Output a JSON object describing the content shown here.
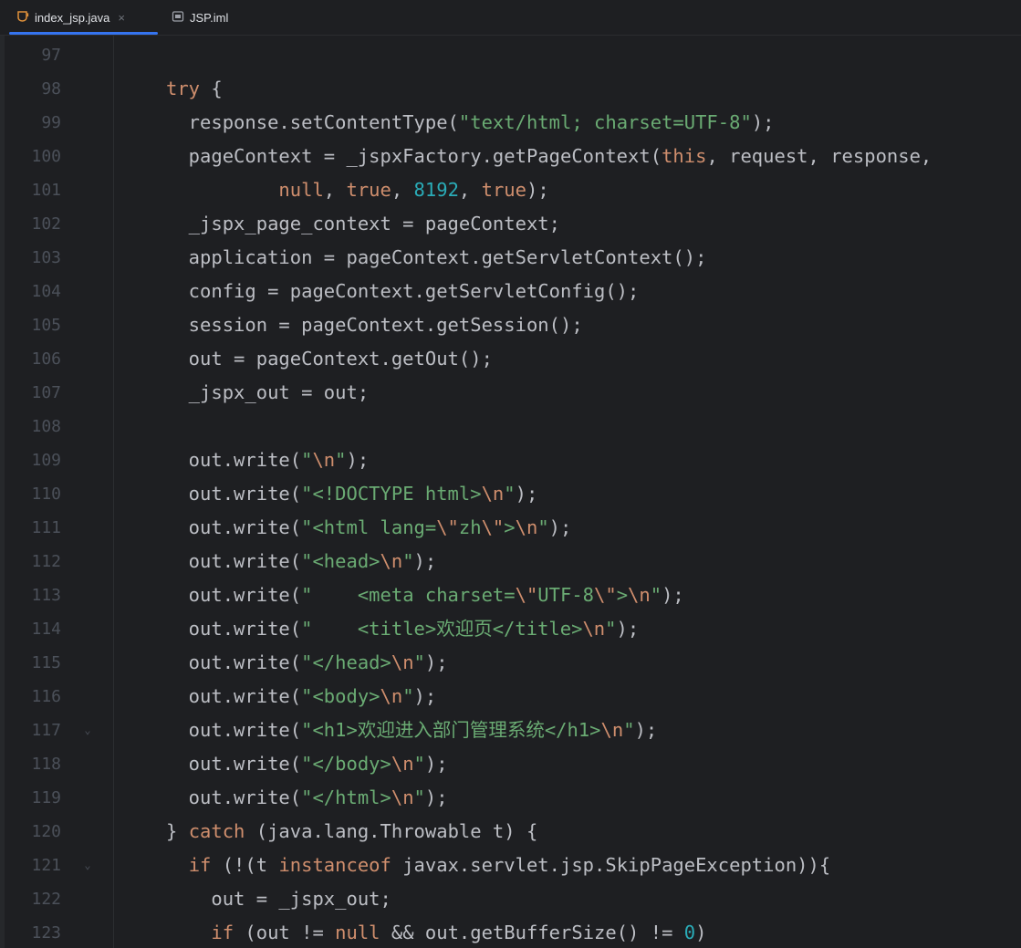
{
  "tabs": [
    {
      "label": "index_jsp.java",
      "active": true,
      "icon": "java-file-icon",
      "close": "×"
    },
    {
      "label": "JSP.iml",
      "active": false,
      "icon": "module-file-icon"
    }
  ],
  "colors": {
    "background": "#1e1f22",
    "text": "#bcbec4",
    "keyword": "#cf8e6d",
    "string": "#6aab73",
    "number": "#2aacb8",
    "line_number": "#4b5059",
    "accent": "#3574f0"
  },
  "fold_markers": {
    "117": "⌄",
    "121": "⌄"
  },
  "lines": [
    {
      "n": "97",
      "tokens": []
    },
    {
      "n": "98",
      "tokens": [
        [
          "k",
          "try"
        ],
        [
          "t",
          " {"
        ]
      ]
    },
    {
      "n": "99",
      "tokens": [
        [
          "t",
          "  response.setContentType("
        ],
        [
          "s",
          "\"text/html; charset=UTF-8\""
        ],
        [
          "t",
          ");"
        ]
      ]
    },
    {
      "n": "100",
      "tokens": [
        [
          "t",
          "  pageContext = _jspxFactory.getPageContext("
        ],
        [
          "k",
          "this"
        ],
        [
          "t",
          ", request, response,"
        ]
      ]
    },
    {
      "n": "101",
      "tokens": [
        [
          "t",
          "          "
        ],
        [
          "k",
          "null"
        ],
        [
          "t",
          ", "
        ],
        [
          "k",
          "true"
        ],
        [
          "t",
          ", "
        ],
        [
          "n",
          "8192"
        ],
        [
          "t",
          ", "
        ],
        [
          "k",
          "true"
        ],
        [
          "t",
          ");"
        ]
      ]
    },
    {
      "n": "102",
      "tokens": [
        [
          "t",
          "  _jspx_page_context = pageContext;"
        ]
      ]
    },
    {
      "n": "103",
      "tokens": [
        [
          "t",
          "  application = pageContext.getServletContext();"
        ]
      ]
    },
    {
      "n": "104",
      "tokens": [
        [
          "t",
          "  config = pageContext.getServletConfig();"
        ]
      ]
    },
    {
      "n": "105",
      "tokens": [
        [
          "t",
          "  session = pageContext.getSession();"
        ]
      ]
    },
    {
      "n": "106",
      "tokens": [
        [
          "t",
          "  out = pageContext.getOut();"
        ]
      ]
    },
    {
      "n": "107",
      "tokens": [
        [
          "t",
          "  _jspx_out = out;"
        ]
      ]
    },
    {
      "n": "108",
      "tokens": []
    },
    {
      "n": "109",
      "tokens": [
        [
          "t",
          "  out.write("
        ],
        [
          "s",
          "\""
        ],
        [
          "e",
          "\\n"
        ],
        [
          "s",
          "\""
        ],
        [
          "t",
          ");"
        ]
      ]
    },
    {
      "n": "110",
      "tokens": [
        [
          "t",
          "  out.write("
        ],
        [
          "s",
          "\"<!DOCTYPE html>"
        ],
        [
          "e",
          "\\n"
        ],
        [
          "s",
          "\""
        ],
        [
          "t",
          ");"
        ]
      ]
    },
    {
      "n": "111",
      "tokens": [
        [
          "t",
          "  out.write("
        ],
        [
          "s",
          "\"<html lang="
        ],
        [
          "e",
          "\\\""
        ],
        [
          "s",
          "zh"
        ],
        [
          "e",
          "\\\""
        ],
        [
          "s",
          ">"
        ],
        [
          "e",
          "\\n"
        ],
        [
          "s",
          "\""
        ],
        [
          "t",
          ");"
        ]
      ]
    },
    {
      "n": "112",
      "tokens": [
        [
          "t",
          "  out.write("
        ],
        [
          "s",
          "\"<head>"
        ],
        [
          "e",
          "\\n"
        ],
        [
          "s",
          "\""
        ],
        [
          "t",
          ");"
        ]
      ]
    },
    {
      "n": "113",
      "tokens": [
        [
          "t",
          "  out.write("
        ],
        [
          "s",
          "\"    <meta charset="
        ],
        [
          "e",
          "\\\""
        ],
        [
          "s",
          "UTF-8"
        ],
        [
          "e",
          "\\\""
        ],
        [
          "s",
          ">"
        ],
        [
          "e",
          "\\n"
        ],
        [
          "s",
          "\""
        ],
        [
          "t",
          ");"
        ]
      ]
    },
    {
      "n": "114",
      "tokens": [
        [
          "t",
          "  out.write("
        ],
        [
          "s",
          "\"    <title>欢迎页</title>"
        ],
        [
          "e",
          "\\n"
        ],
        [
          "s",
          "\""
        ],
        [
          "t",
          ");"
        ]
      ]
    },
    {
      "n": "115",
      "tokens": [
        [
          "t",
          "  out.write("
        ],
        [
          "s",
          "\"</head>"
        ],
        [
          "e",
          "\\n"
        ],
        [
          "s",
          "\""
        ],
        [
          "t",
          ");"
        ]
      ]
    },
    {
      "n": "116",
      "tokens": [
        [
          "t",
          "  out.write("
        ],
        [
          "s",
          "\"<body>"
        ],
        [
          "e",
          "\\n"
        ],
        [
          "s",
          "\""
        ],
        [
          "t",
          ");"
        ]
      ]
    },
    {
      "n": "117",
      "tokens": [
        [
          "t",
          "  out.write("
        ],
        [
          "s",
          "\"<h1>欢迎进入部门管理系统</h1>"
        ],
        [
          "e",
          "\\n"
        ],
        [
          "s",
          "\""
        ],
        [
          "t",
          ");"
        ]
      ]
    },
    {
      "n": "118",
      "tokens": [
        [
          "t",
          "  out.write("
        ],
        [
          "s",
          "\"</body>"
        ],
        [
          "e",
          "\\n"
        ],
        [
          "s",
          "\""
        ],
        [
          "t",
          ");"
        ]
      ]
    },
    {
      "n": "119",
      "tokens": [
        [
          "t",
          "  out.write("
        ],
        [
          "s",
          "\"</html>"
        ],
        [
          "e",
          "\\n"
        ],
        [
          "s",
          "\""
        ],
        [
          "t",
          ");"
        ]
      ]
    },
    {
      "n": "120",
      "tokens": [
        [
          "t",
          "} "
        ],
        [
          "k",
          "catch"
        ],
        [
          "t",
          " (java.lang.Throwable t) {"
        ]
      ]
    },
    {
      "n": "121",
      "tokens": [
        [
          "t",
          "  "
        ],
        [
          "k",
          "if"
        ],
        [
          "t",
          " (!(t "
        ],
        [
          "k",
          "instanceof"
        ],
        [
          "t",
          " javax.servlet.jsp.SkipPageException)){"
        ]
      ]
    },
    {
      "n": "122",
      "tokens": [
        [
          "t",
          "    out = _jspx_out;"
        ]
      ]
    },
    {
      "n": "123",
      "tokens": [
        [
          "t",
          "    "
        ],
        [
          "k",
          "if"
        ],
        [
          "t",
          " (out != "
        ],
        [
          "k",
          "null"
        ],
        [
          "t",
          " && out.getBufferSize() != "
        ],
        [
          "n",
          "0"
        ],
        [
          "t",
          ")"
        ]
      ]
    }
  ]
}
